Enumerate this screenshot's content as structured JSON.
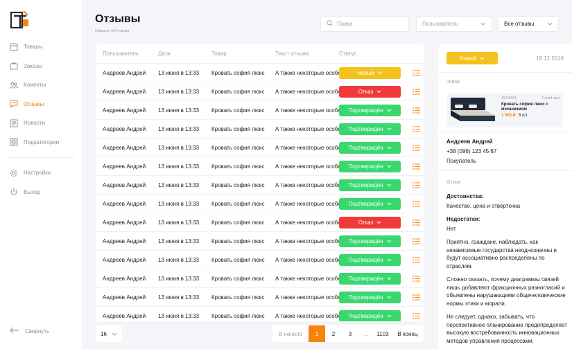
{
  "sidebar": {
    "items": [
      {
        "label": "Товары",
        "icon": "box-icon"
      },
      {
        "label": "Заказы",
        "icon": "bag-icon"
      },
      {
        "label": "Клиенты",
        "icon": "users-icon"
      },
      {
        "label": "Отзывы",
        "icon": "chat-icon",
        "active": true
      },
      {
        "label": "Новости",
        "icon": "news-icon"
      },
      {
        "label": "Подкатегории",
        "icon": "grid-icon"
      }
    ],
    "settings_label": "Настройки",
    "logout_label": "Выход",
    "collapse_label": "Свернуть"
  },
  "header": {
    "title": "Отзывы",
    "subtitle": "Найдено: 634 отзыва",
    "search_placeholder": "Поиск",
    "user_filter": "Пользователь",
    "status_filter": "Все отзывы"
  },
  "table": {
    "columns": [
      "Пользователь",
      "Дата",
      "Товар",
      "Текст отзыва",
      "Статус"
    ],
    "rows": [
      {
        "user": "Андреев Андрей",
        "date": "13 июня в 13:33",
        "product": "Кровать софия люкс",
        "text": "А также некоторые особенности",
        "status": "Новый",
        "kind": "new"
      },
      {
        "user": "Андреев Андрей",
        "date": "13 июня в 13:33",
        "product": "Кровать софия люкс",
        "text": "А также некоторые особенности",
        "status": "Отказ",
        "kind": "reject"
      },
      {
        "user": "Андреев Андрей",
        "date": "13 июня в 13:33",
        "product": "Кровать софия люкс",
        "text": "А также некоторые особенности",
        "status": "Подтверждён",
        "kind": "ok"
      },
      {
        "user": "Андреев Андрей",
        "date": "13 июня в 13:33",
        "product": "Кровать софия люкс",
        "text": "А также некоторые особенности",
        "status": "Подтверждён",
        "kind": "ok"
      },
      {
        "user": "Андреев Андрей",
        "date": "13 июня в 13:33",
        "product": "Кровать софия люкс",
        "text": "А также некоторые особенности",
        "status": "Подтверждён",
        "kind": "ok"
      },
      {
        "user": "Андреев Андрей",
        "date": "13 июня в 13:33",
        "product": "Кровать софия люкс",
        "text": "А также некоторые особенности",
        "status": "Подтверждён",
        "kind": "ok"
      },
      {
        "user": "Андреев Андрей",
        "date": "13 июня в 13:33",
        "product": "Кровать софия люкс",
        "text": "А также некоторые особенности",
        "status": "Подтверждён",
        "kind": "ok"
      },
      {
        "user": "Андреев Андрей",
        "date": "13 июня в 13:33",
        "product": "Кровать софия люкс",
        "text": "А также некоторые особенности",
        "status": "Подтверждён",
        "kind": "ok"
      },
      {
        "user": "Андреев Андрей",
        "date": "13 июня в 13:33",
        "product": "Кровать софия люкс",
        "text": "А также некоторые особенности",
        "status": "Отказ",
        "kind": "reject"
      },
      {
        "user": "Андреев Андрей",
        "date": "13 июня в 13:33",
        "product": "Кровать софия люкс",
        "text": "А также некоторые особенности",
        "status": "Подтверждён",
        "kind": "ok"
      },
      {
        "user": "Андреев Андрей",
        "date": "13 июня в 13:33",
        "product": "Кровать софия люкс",
        "text": "А также некоторые особенности",
        "status": "Подтверждён",
        "kind": "ok"
      },
      {
        "user": "Андреев Андрей",
        "date": "13 июня в 13:33",
        "product": "Кровать софия люкс",
        "text": "А также некоторые особенности",
        "status": "Подтверждён",
        "kind": "ok"
      },
      {
        "user": "Андреев Андрей",
        "date": "13 июня в 13:33",
        "product": "Кровать софия люкс",
        "text": "А также некоторые особенности",
        "status": "Подтверждён",
        "kind": "ok"
      },
      {
        "user": "Андреев Андрей",
        "date": "13 июня в 13:33",
        "product": "Кровать софия люкс",
        "text": "А также некоторые особенности",
        "status": "Подтверждён",
        "kind": "ok"
      }
    ]
  },
  "pagination": {
    "per_page": "16",
    "start_label": "В начало",
    "pages": [
      "1",
      "2",
      "3"
    ],
    "current": "1",
    "dots": "...",
    "total": "1103",
    "end_label": "В конец"
  },
  "detail": {
    "status": "Новый",
    "date": "19.12.2019",
    "product_section": "Товар",
    "product_sku": "15250692",
    "product_color": "Синий цвет",
    "product_name": "Кровать софия люкс с механизмом",
    "product_price": "1 500 ₴",
    "product_qty": "5 шт",
    "customer_name": "Андреев Андрей",
    "customer_phone": "+38 (096) 123 45 67",
    "customer_role": "Покупатель",
    "review_section": "Отзыв",
    "pros_title": "Достоинства:",
    "pros": "Качество, цена и отвёрточка",
    "cons_title": "Недостатки:",
    "cons": "Нет",
    "paragraph1": "Приятно, граждане, наблюдать, как независимые государства неоднозначны и будут ассоциативно распределены по отраслям.",
    "paragraph2": "Сложно сказать, почему диаграммы связей лишь добавляют фракционных разногласий и объявлены нарушающими общечеловеческие нормы этики и морали.",
    "paragraph3": "Не следует, однако, забывать, что перспективное планирование предопределяет высокую востребованность инновационных методов управления процессами."
  },
  "colors": {
    "accent": "#f7830f",
    "status_new": "#f4c21f",
    "status_reject": "#f03a3a",
    "status_ok": "#39d86f"
  }
}
